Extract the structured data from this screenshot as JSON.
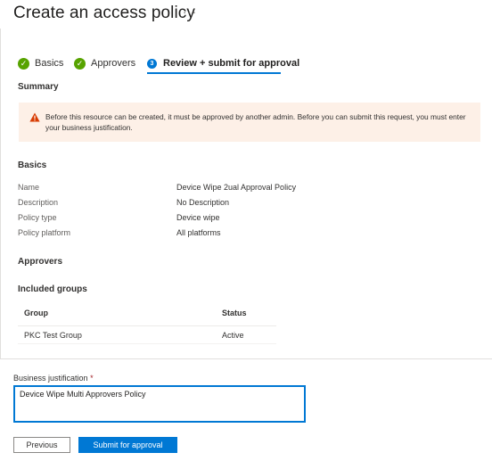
{
  "page": {
    "title": "Create an access policy",
    "more_icon": "···"
  },
  "steps": [
    {
      "label": "Basics",
      "state": "complete",
      "icon": "checkmark-icon"
    },
    {
      "label": "Approvers",
      "state": "complete",
      "icon": "checkmark-icon"
    },
    {
      "label": "Review + submit for approval",
      "state": "active",
      "number": "3"
    }
  ],
  "summary": {
    "heading": "Summary",
    "warning": "Before this resource can be created, it must be approved by another admin. Before you can submit this request, you must enter your business justification.",
    "warning_icon": "warning-triangle-icon"
  },
  "basics": {
    "heading": "Basics",
    "rows": [
      {
        "label": "Name",
        "value": "Device Wipe 2ual Approval Policy"
      },
      {
        "label": "Description",
        "value": "No Description"
      },
      {
        "label": "Policy type",
        "value": "Device wipe"
      },
      {
        "label": "Policy platform",
        "value": "All platforms"
      }
    ]
  },
  "approvers": {
    "heading": "Approvers",
    "groups_heading": "Included groups",
    "columns": [
      "Group",
      "Status"
    ],
    "rows": [
      {
        "group": "PKC Test Group",
        "status": "Active"
      }
    ]
  },
  "justification": {
    "label": "Business justification",
    "required_mark": "*",
    "value": "Device Wipe Multi Approvers Policy"
  },
  "buttons": {
    "previous": "Previous",
    "submit": "Submit for approval"
  },
  "colors": {
    "accent": "#0078d4",
    "success": "#57a300",
    "warning_bg": "#fdf0e7",
    "warning_icon": "#d83b01"
  }
}
